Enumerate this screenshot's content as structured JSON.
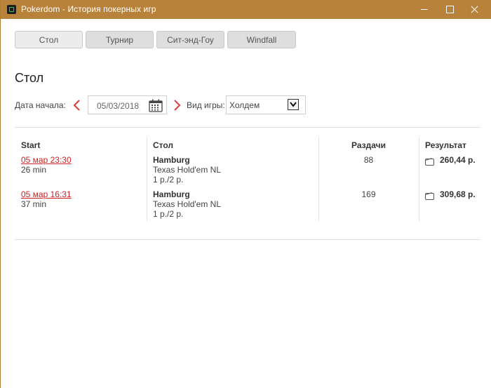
{
  "window": {
    "title": "Pokerdom - История покерных игр"
  },
  "tabs": [
    {
      "label": "Стол"
    },
    {
      "label": "Турнир"
    },
    {
      "label": "Сит-энд-Гоу"
    },
    {
      "label": "Windfall"
    }
  ],
  "heading": "Стол",
  "filters": {
    "date_label": "Дата начала:",
    "date_value": "05/03/2018",
    "game_type_label": "Вид игры:",
    "game_type_value": "Холдем"
  },
  "table": {
    "columns": {
      "start": "Start",
      "table": "Стол",
      "hands": "Раздачи",
      "result": "Результат"
    },
    "rows": [
      {
        "start": "05 мар 23:30",
        "duration": "26 min",
        "table_name": "Hamburg",
        "game": "Texas Hold'em NL",
        "stakes": "1 р./2 р.",
        "hands": "88",
        "result": "260,44 р."
      },
      {
        "start": "05 мар 16:31",
        "duration": "37 min",
        "table_name": "Hamburg",
        "game": "Texas Hold'em NL",
        "stakes": "1 р./2 р.",
        "hands": "169",
        "result": "309,68 р."
      }
    ]
  },
  "colors": {
    "titlebar": "#b9823a",
    "link": "#d01f1f",
    "arrow": "#e03a3a"
  },
  "icons": [
    "app-icon",
    "minimize-icon",
    "maximize-icon",
    "close-icon",
    "chevron-left-icon",
    "chevron-right-icon",
    "calendar-icon",
    "dropdown-arrow-icon",
    "wallet-icon"
  ]
}
